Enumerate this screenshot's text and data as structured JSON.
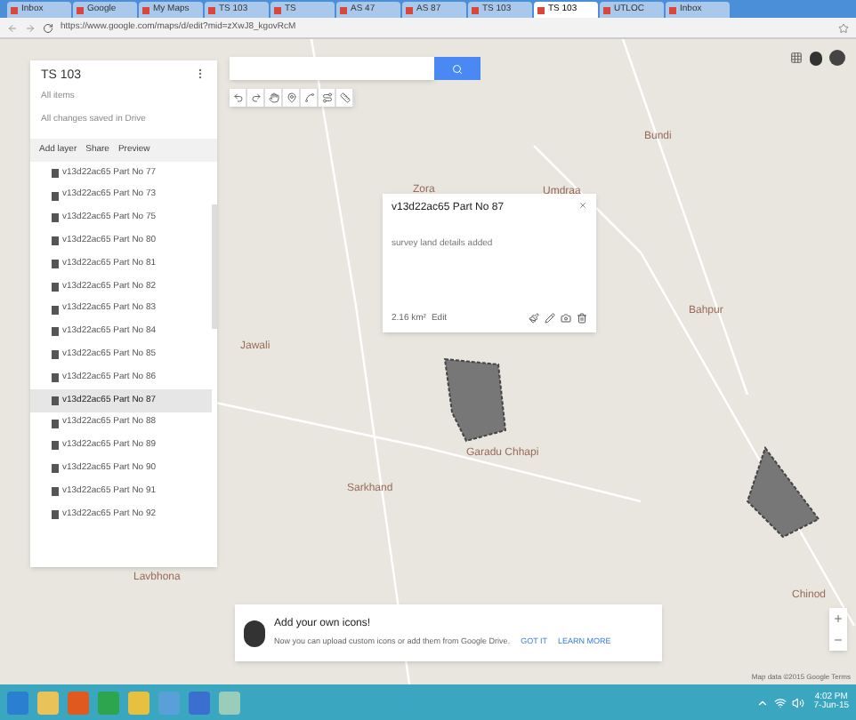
{
  "browser": {
    "tabs": [
      {
        "title": "Inbox",
        "selected": false
      },
      {
        "title": "Google",
        "selected": false
      },
      {
        "title": "My Maps",
        "selected": false
      },
      {
        "title": "TS 103",
        "selected": false
      },
      {
        "title": "TS",
        "selected": false
      },
      {
        "title": "AS 47",
        "selected": false
      },
      {
        "title": "AS 87",
        "selected": false
      },
      {
        "title": "TS 103",
        "selected": false
      },
      {
        "title": "TS 103",
        "selected": true
      },
      {
        "title": "UTLOC",
        "selected": false
      },
      {
        "title": "Inbox",
        "selected": false
      }
    ],
    "url": "https://www.google.com/maps/d/edit?mid=zXwJ8_kgovRcM"
  },
  "panel": {
    "title": "TS 103",
    "subtitle": "All items",
    "status": "All changes saved in Drive",
    "actions": [
      "Add layer",
      "Share",
      "Preview"
    ],
    "items": [
      {
        "label": "v13d22ac65 Part No 77",
        "selected": false
      },
      {
        "label": "v13d22ac65 Part No 73",
        "selected": false
      },
      {
        "label": "v13d22ac65 Part No 75",
        "selected": false
      },
      {
        "label": "v13d22ac65 Part No 80",
        "selected": false
      },
      {
        "label": "v13d22ac65 Part No 81",
        "selected": false
      },
      {
        "label": "v13d22ac65 Part No 82",
        "selected": false
      },
      {
        "label": "v13d22ac65 Part No 83",
        "selected": false
      },
      {
        "label": "v13d22ac65 Part No 84",
        "selected": false
      },
      {
        "label": "v13d22ac65 Part No 85",
        "selected": false
      },
      {
        "label": "v13d22ac65 Part No 86",
        "selected": false
      },
      {
        "label": "v13d22ac65 Part No 87",
        "selected": true
      },
      {
        "label": "v13d22ac65 Part No 88",
        "selected": false
      },
      {
        "label": "v13d22ac65 Part No 89",
        "selected": false
      },
      {
        "label": "v13d22ac65 Part No 90",
        "selected": false
      },
      {
        "label": "v13d22ac65 Part No 91",
        "selected": false
      },
      {
        "label": "v13d22ac65 Part No 92",
        "selected": false
      }
    ]
  },
  "map": {
    "labels": [
      "Bundi",
      "Umdraa",
      "Zora",
      "Bahpur",
      "Garadu Chhapi",
      "Sarkhand",
      "Lavbhona",
      "Chinod",
      "Jawali"
    ],
    "popup": {
      "title": "v13d22ac65 Part No 87",
      "description": "survey land details added",
      "area": "2.16 km²",
      "edit": "Edit"
    },
    "attribution": "Map data ©2015 Google  Terms"
  },
  "toast": {
    "title": "Add your own icons!",
    "text": "Now you can upload custom icons or add them from Google Drive.",
    "buttons": [
      "GOT IT",
      "LEARN MORE"
    ]
  },
  "taskbar": {
    "time": "4:02 PM",
    "date": "7-Jun-15"
  }
}
